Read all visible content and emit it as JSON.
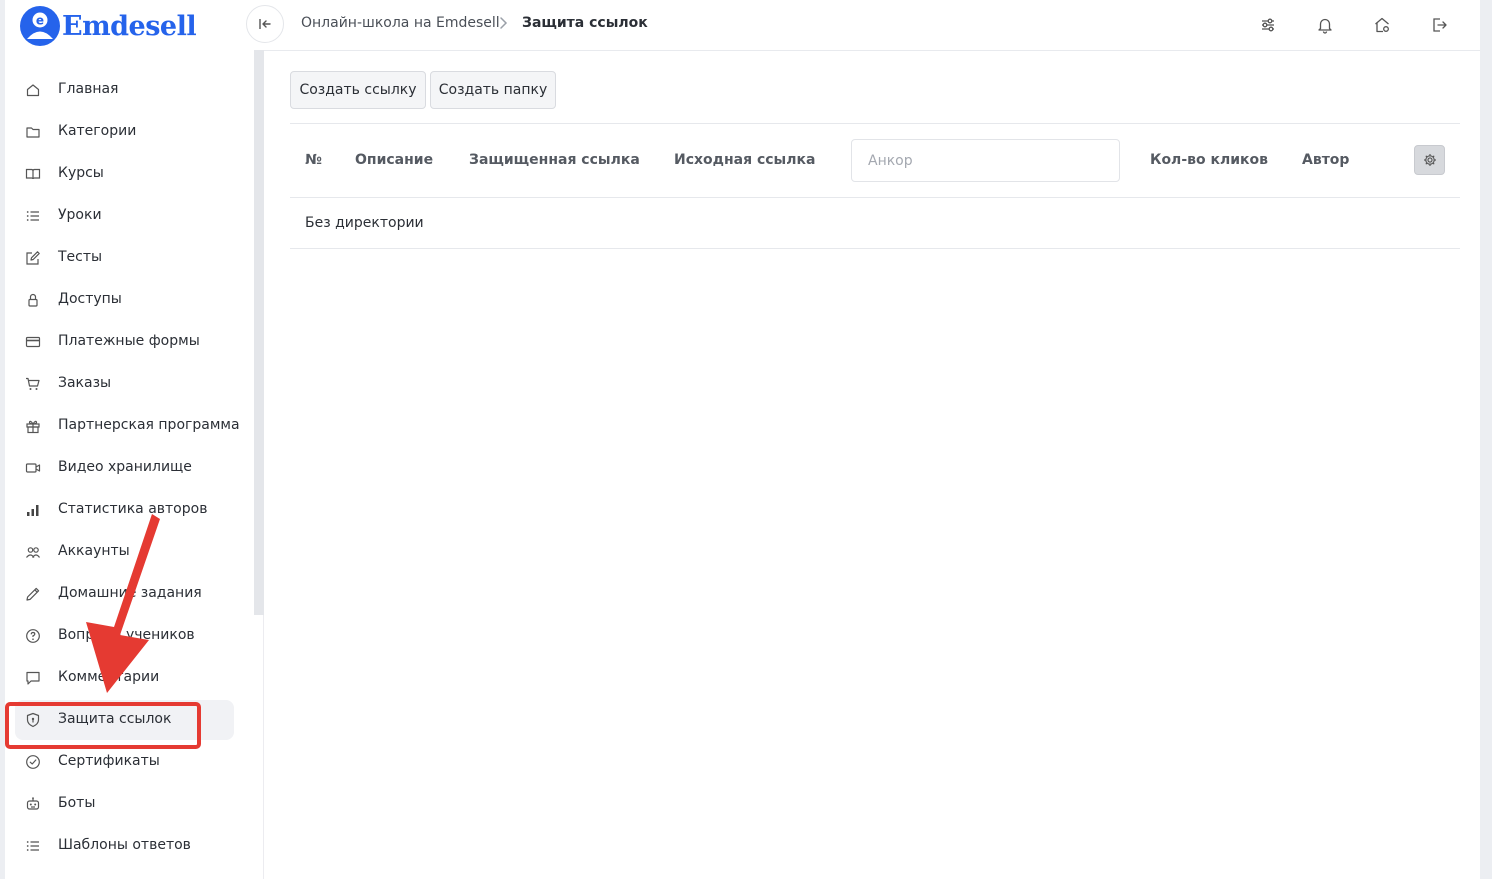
{
  "brand": {
    "name": "Emdesell",
    "color": "#2563eb"
  },
  "breadcrumb": {
    "parent": "Онлайн-школа на Emdesell",
    "current": "Защита ссылок"
  },
  "topbar_icons": [
    "sliders-icon",
    "bell-icon",
    "home-settings-icon",
    "logout-icon"
  ],
  "sidebar": {
    "items": [
      {
        "label": "Главная",
        "icon": "home-icon"
      },
      {
        "label": "Категории",
        "icon": "folder-icon"
      },
      {
        "label": "Курсы",
        "icon": "book-icon"
      },
      {
        "label": "Уроки",
        "icon": "list-icon"
      },
      {
        "label": "Тесты",
        "icon": "edit-icon"
      },
      {
        "label": "Доступы",
        "icon": "lock-icon"
      },
      {
        "label": "Платежные формы",
        "icon": "credit-card-icon"
      },
      {
        "label": "Заказы",
        "icon": "cart-icon"
      },
      {
        "label": "Партнерская программа",
        "icon": "gift-icon"
      },
      {
        "label": "Видео хранилище",
        "icon": "video-icon"
      },
      {
        "label": "Статистика авторов",
        "icon": "bar-chart-icon"
      },
      {
        "label": "Аккаунты",
        "icon": "users-icon"
      },
      {
        "label": "Домашние задания",
        "icon": "pencil-icon"
      },
      {
        "label": "Вопросы учеников",
        "icon": "help-circle-icon"
      },
      {
        "label": "Комментарии",
        "icon": "comment-icon"
      },
      {
        "label": "Защита ссылок",
        "icon": "shield-icon",
        "active": true
      },
      {
        "label": "Сертификаты",
        "icon": "check-circle-icon"
      },
      {
        "label": "Боты",
        "icon": "robot-icon"
      },
      {
        "label": "Шаблоны ответов",
        "icon": "list-icon"
      }
    ]
  },
  "toolbar": {
    "create_link": "Создать ссылку",
    "create_folder": "Создать папку"
  },
  "table": {
    "columns": {
      "number": "№",
      "description": "Описание",
      "protected_link": "Защищенная ссылка",
      "source_link": "Исходная ссылка",
      "clicks": "Кол-во кликов",
      "author": "Автор"
    },
    "anchor_placeholder": "Анкор",
    "rows": [
      {
        "label": "Без директории"
      }
    ]
  },
  "annotation": {
    "color": "#e53a32",
    "target": "Защита ссылок"
  }
}
